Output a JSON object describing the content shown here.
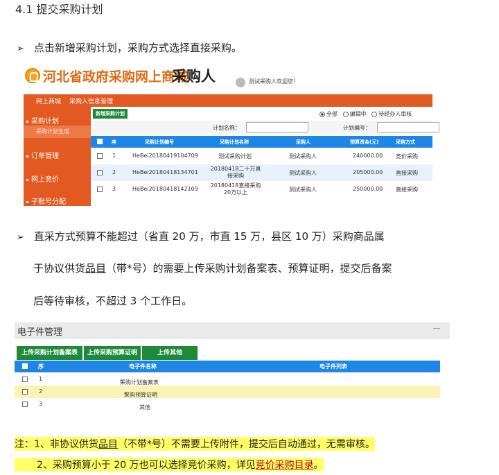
{
  "heading": "4.1 提交采购计划",
  "step1": "点击新增采购计划，采购方式选择直接采购。",
  "bullet": "➢",
  "portal": {
    "logo_text": "河北省政府采购网上商城",
    "logo_sub": "采购人",
    "welcome": "测试采购人欢迎您！",
    "nav": [
      "网上商城",
      "采购人信息管理"
    ],
    "sidebar": {
      "items": [
        "采购计划",
        "订单管理",
        "网上竞价",
        "子账号分配"
      ],
      "sub_item": "采购计划生成"
    },
    "add_button": "新增采购计划",
    "filters": {
      "all": "全部",
      "editing": "编辑中",
      "pending": "待经办人审核"
    },
    "search": {
      "plan_name_label": "计划名称：",
      "plan_no_label": "计划编号："
    },
    "table": {
      "headers": [
        "序",
        "采购计划编号",
        "采购计划名称",
        "采购人",
        "预算资金(元)",
        "采购方式"
      ],
      "rows": [
        {
          "no": "1",
          "code": "HeBei20180419104709",
          "name": "测试采购计划",
          "buyer": "测试采购人",
          "budget": "240000.00",
          "method": "竞价采购"
        },
        {
          "no": "2",
          "code": "HeBei20180418134701",
          "name": "20180418二十万直接采购",
          "buyer": "测试采购人",
          "budget": "205000.00",
          "method": "直接采购"
        },
        {
          "no": "3",
          "code": "HeBei20180418142109",
          "name": "20180418直接采购20万以上",
          "buyer": "测试采购人",
          "budget": "250000.00",
          "method": "直接采购"
        }
      ]
    }
  },
  "step2": {
    "line1": "直采方式预算不能超过（省直 20 万，市直 15 万，县区 10 万）采购商品属",
    "line2_a": "于协议供货",
    "line2_ul": "品目",
    "line2_b": "（带*号）的需要上传采购计划备案表、预算证明，提交后",
    "line2_c": "备案",
    "line3": "后等待审核，不超过 3 个工作日。"
  },
  "efile": {
    "title": "电子件管理",
    "buttons": [
      "上传采购计划备案表",
      "上传采购预算证明",
      "上传其他"
    ],
    "headers": [
      "序",
      "电子件名称",
      "电子件列表"
    ],
    "rows": [
      {
        "no": "1",
        "name": "采购计划备案表",
        "star": "*"
      },
      {
        "no": "2",
        "name": "采购预算证明",
        "star": "*"
      },
      {
        "no": "3",
        "name": "其他",
        "star": ""
      }
    ]
  },
  "notes": {
    "n1_a": "注：1、非协议供货",
    "n1_ul": "品目",
    "n1_b": "（不带*号）不需要上传附件，提交后自动通过，无需审核。",
    "n2_a": "2、采购预算小于 20 万也可以选择竞价采购，详见",
    "n2_link": "竞价采购目录",
    "n2_b": "。"
  }
}
